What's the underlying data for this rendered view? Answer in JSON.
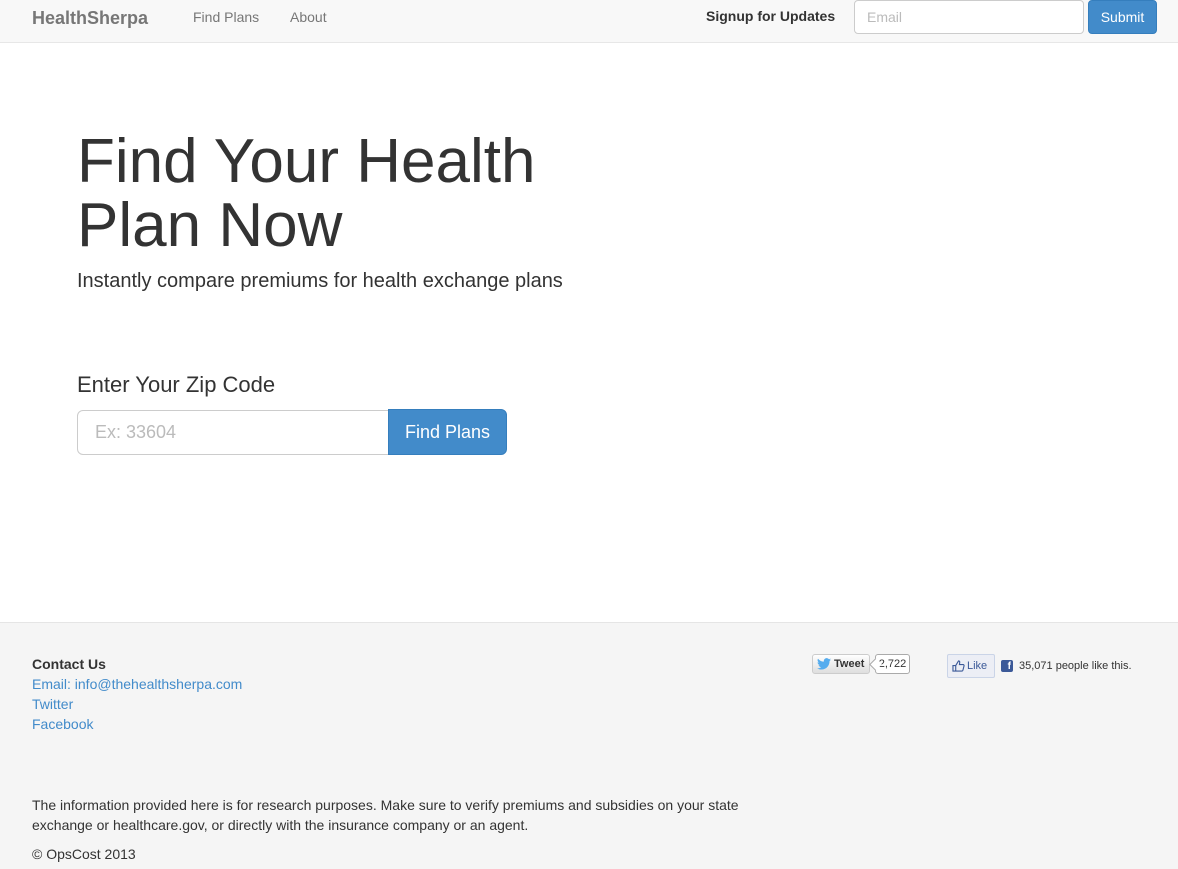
{
  "navbar": {
    "brand": "HealthSherpa",
    "links": [
      "Find Plans",
      "About"
    ],
    "signup_label": "Signup for Updates",
    "email_placeholder": "Email",
    "submit_label": "Submit"
  },
  "hero": {
    "title": "Find Your Health Plan Now",
    "subtitle": "Instantly compare premiums for health exchange plans",
    "zip_label": "Enter Your Zip Code",
    "zip_placeholder": "Ex: 33604",
    "find_button": "Find Plans"
  },
  "footer": {
    "contact_title": "Contact Us",
    "email_link": "Email: info@thehealthsherpa.com",
    "twitter_link": "Twitter",
    "facebook_link": "Facebook",
    "disclaimer": "The information provided here is for research purposes. Make sure to verify premiums and subsidies on your state exchange or healthcare.gov, or directly with the insurance company or an agent.",
    "copyright": "© OpsCost 2013"
  },
  "social": {
    "tweet_label": "Tweet",
    "tweet_count": "2,722",
    "like_label": "Like",
    "like_count_text": "35,071 people like this.",
    "twitter_color": "#55acee",
    "facebook_color": "#3b5998"
  },
  "colors": {
    "primary": "#428bca",
    "navbar_bg": "#f8f8f8",
    "footer_bg": "#f5f5f5"
  }
}
